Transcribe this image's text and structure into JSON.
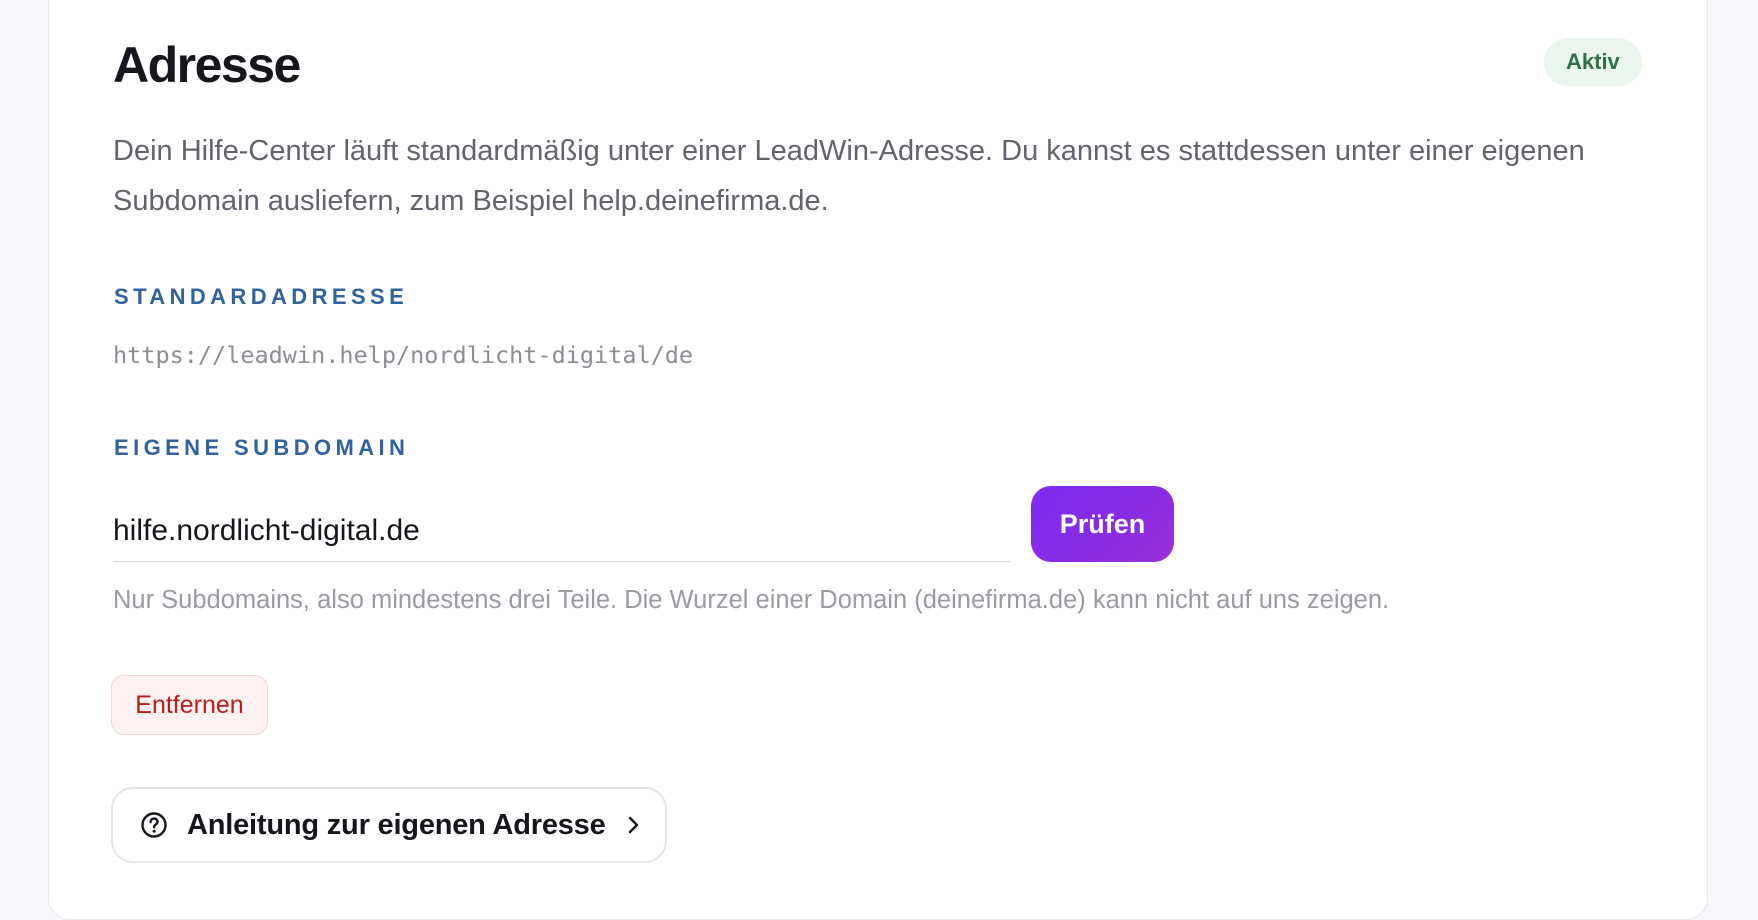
{
  "card": {
    "title": "Adresse",
    "status_badge": "Aktiv",
    "description": "Dein Hilfe-Center läuft standardmäßig unter einer LeadWin-Adresse. Du kannst es stattdessen unter einer eigenen Subdomain ausliefern, zum Beispiel help.deinefirma.de."
  },
  "standard_address": {
    "label": "STANDARDADRESSE",
    "url": "https://leadwin.help/nordlicht-digital/de"
  },
  "custom_subdomain": {
    "label": "EIGENE SUBDOMAIN",
    "value": "hilfe.nordlicht-digital.de",
    "check_button_label": "Prüfen",
    "hint": "Nur Subdomains, also mindestens drei Teile. Die Wurzel einer Domain (deinefirma.de) kann nicht auf uns zeigen."
  },
  "actions": {
    "remove_label": "Entfernen",
    "guide_label": "Anleitung zur eigenen Adresse",
    "guide_icon": "help-circle-icon",
    "guide_chevron_icon": "chevron-right-icon"
  },
  "colors": {
    "accent": "#7c2cf2",
    "section_label": "#30629e",
    "status_bg": "#ebf6ef",
    "status_text": "#2e7048",
    "danger": "#b91c1c"
  }
}
